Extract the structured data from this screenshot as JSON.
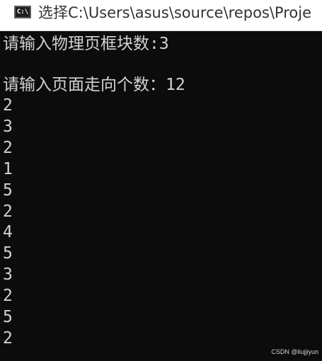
{
  "window": {
    "icon_text": "C:\\",
    "title": "选择C:\\Users\\asus\\source\\repos\\Proje"
  },
  "console": {
    "lines": [
      "请输入物理页框块数:3",
      "",
      "请输入页面走向个数：12",
      "2",
      "3",
      "2",
      "1",
      "5",
      "2",
      "4",
      "5",
      "3",
      "2",
      "5",
      "2"
    ]
  },
  "watermark": "CSDN @liujjiyun"
}
